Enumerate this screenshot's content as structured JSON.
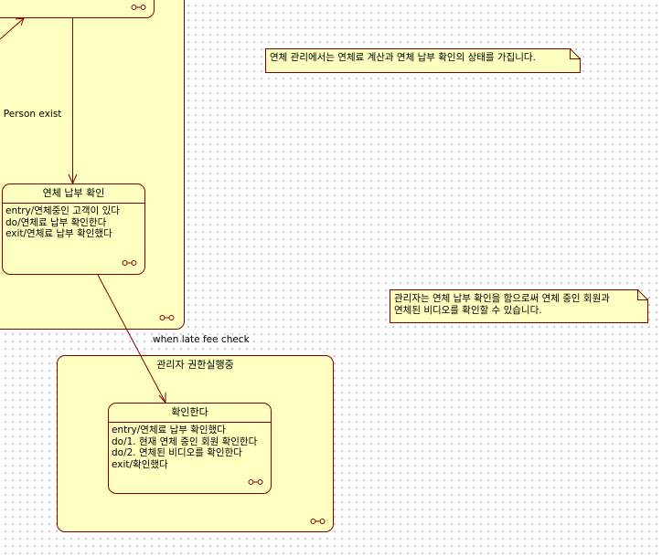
{
  "diagram": {
    "composite_overdue": {
      "history_icon": "history-connector-icon"
    },
    "top_state": {
      "history_icon": "history-connector-icon"
    },
    "transition_person_exist": {
      "label": "e Person exist"
    },
    "state_overdue_payment_check": {
      "name": "연체 납부 확인",
      "actions": [
        "entry/연체중인 고객이 있다",
        "do/연체료 납부 확인한다",
        "exit/연체료 납부 확인했다"
      ]
    },
    "transition_late_fee": {
      "label": "when late fee check"
    },
    "composite_admin": {
      "name": "관리자 권한실행중"
    },
    "state_confirm": {
      "name": "확인한다",
      "actions": [
        "entry/연체료 납부 확인했다",
        "do/1. 현재 연체 중인 회원 확인한다",
        "do/2. 연체된 비디오를 확인한다",
        "exit/확인했다"
      ]
    },
    "notes": [
      {
        "text": [
          "연체 관리에서는 연체료 계산과 연체 납부 확인의 상태를 가집니다."
        ]
      },
      {
        "text": [
          "관리자는 연체 납부 확인을 함으로써 연체 중인 회원과",
          "연체된 비디오를 확인할 수 있습니다."
        ]
      }
    ],
    "colors": {
      "state_fill": "#ffffc0",
      "line": "#800000"
    }
  }
}
